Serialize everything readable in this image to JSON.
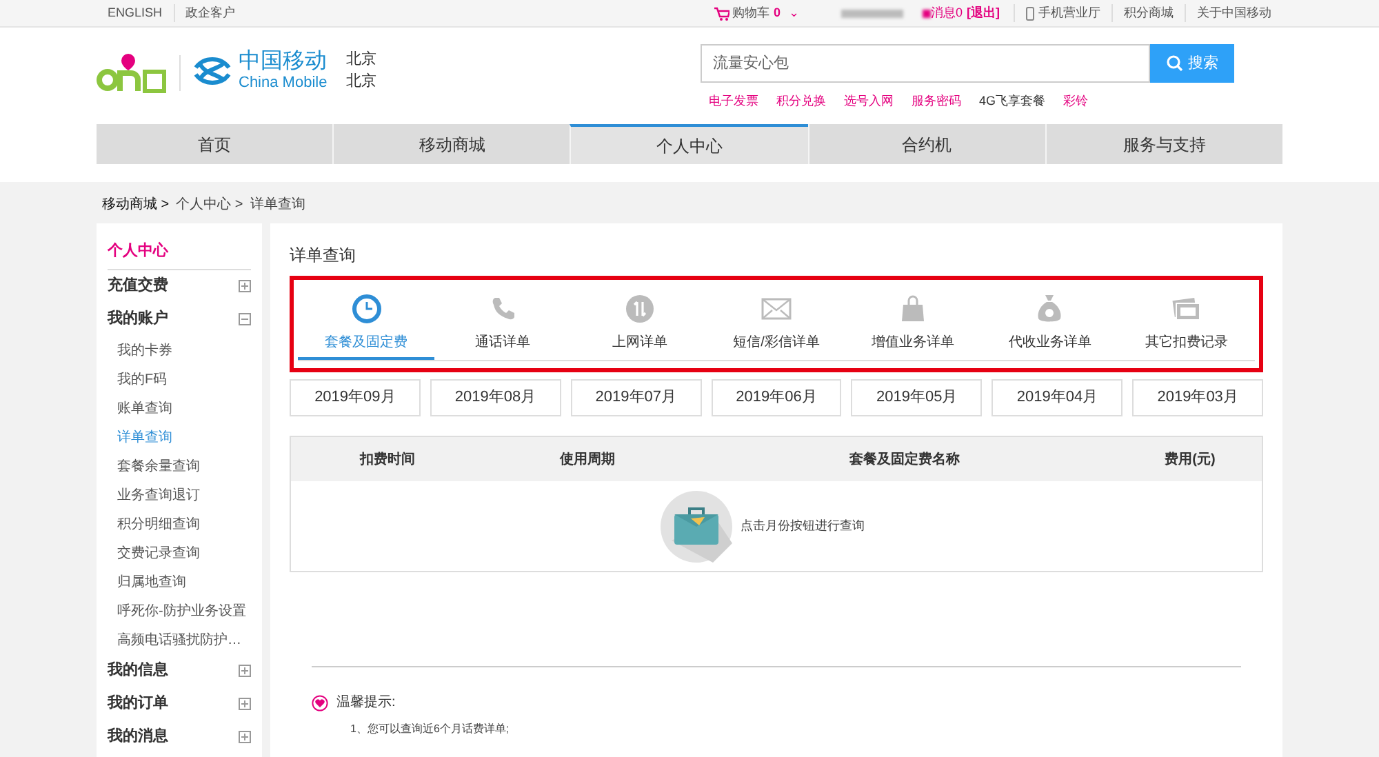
{
  "top_bar": {
    "left_links": [
      "ENGLISH",
      "政企客户"
    ],
    "cart": {
      "label": "购物车",
      "count": "0",
      "caret": "⌄"
    },
    "messages": "消息0",
    "logout": "[退出]",
    "right_links": [
      "手机营业厅",
      "积分商城",
      "关于中国移动"
    ]
  },
  "header": {
    "logo_text": "中国移动",
    "logo_sub": "China Mobile",
    "city": "北京",
    "city_2": "北京",
    "search": {
      "placeholder": "流量安心包",
      "button": "搜索"
    },
    "quick_links": [
      {
        "label": "电子发票",
        "color": "#e4007f"
      },
      {
        "label": "积分兑换",
        "color": "#e4007f"
      },
      {
        "label": "选号入网",
        "color": "#e4007f"
      },
      {
        "label": "服务密码",
        "color": "#e4007f"
      },
      {
        "label": "4G飞享套餐",
        "color": "#333333"
      },
      {
        "label": "彩铃",
        "color": "#e4007f"
      }
    ]
  },
  "nav": [
    {
      "label": "首页",
      "selected": false
    },
    {
      "label": "移动商城",
      "selected": false
    },
    {
      "label": "个人中心",
      "selected": true
    },
    {
      "label": "合约机",
      "selected": false
    },
    {
      "label": "服务与支持",
      "selected": false
    }
  ],
  "breadcrumb": [
    "移动商城 >",
    "个人中心 >",
    "详单查询"
  ],
  "sidebar": {
    "title": "个人中心",
    "groups": [
      {
        "label": "充值交费",
        "expanded": false
      },
      {
        "label": "我的账户",
        "expanded": true,
        "children": [
          {
            "label": "我的卡券",
            "selected": false
          },
          {
            "label": "我的F码",
            "selected": false
          },
          {
            "label": "账单查询",
            "selected": false
          },
          {
            "label": "详单查询",
            "selected": true
          },
          {
            "label": "套餐余量查询",
            "selected": false
          },
          {
            "label": "业务查询退订",
            "selected": false
          },
          {
            "label": "积分明细查询",
            "selected": false
          },
          {
            "label": "交费记录查询",
            "selected": false
          },
          {
            "label": "归属地查询",
            "selected": false
          },
          {
            "label": "呼死你-防护业务设置",
            "selected": false
          },
          {
            "label": "高频电话骚扰防护…",
            "selected": false
          }
        ]
      },
      {
        "label": "我的信息",
        "expanded": false
      },
      {
        "label": "我的订单",
        "expanded": false
      },
      {
        "label": "我的消息",
        "expanded": false
      }
    ]
  },
  "main": {
    "title": "详单查询",
    "detail_tabs": [
      {
        "label": "套餐及固定费",
        "kind": "clock",
        "selected": true
      },
      {
        "label": "通话详单",
        "kind": "phone",
        "selected": false
      },
      {
        "label": "上网详单",
        "kind": "data",
        "selected": false
      },
      {
        "label": "短信/彩信详单",
        "kind": "mail",
        "selected": false
      },
      {
        "label": "增值业务详单",
        "kind": "bag",
        "selected": false
      },
      {
        "label": "代收业务详单",
        "kind": "money",
        "selected": false
      },
      {
        "label": "其它扣费记录",
        "kind": "cards",
        "selected": false
      }
    ],
    "months": [
      "2019年09月",
      "2019年08月",
      "2019年07月",
      "2019年06月",
      "2019年05月",
      "2019年04月",
      "2019年03月"
    ],
    "table": {
      "columns": [
        "扣费时间",
        "使用周期",
        "套餐及固定费名称",
        "费用(元)"
      ],
      "empty_message": "点击月份按钮进行查询"
    },
    "tips": {
      "title": "温馨提示:",
      "items": [
        "1、您可以查询近6个月话费详单;"
      ]
    }
  }
}
